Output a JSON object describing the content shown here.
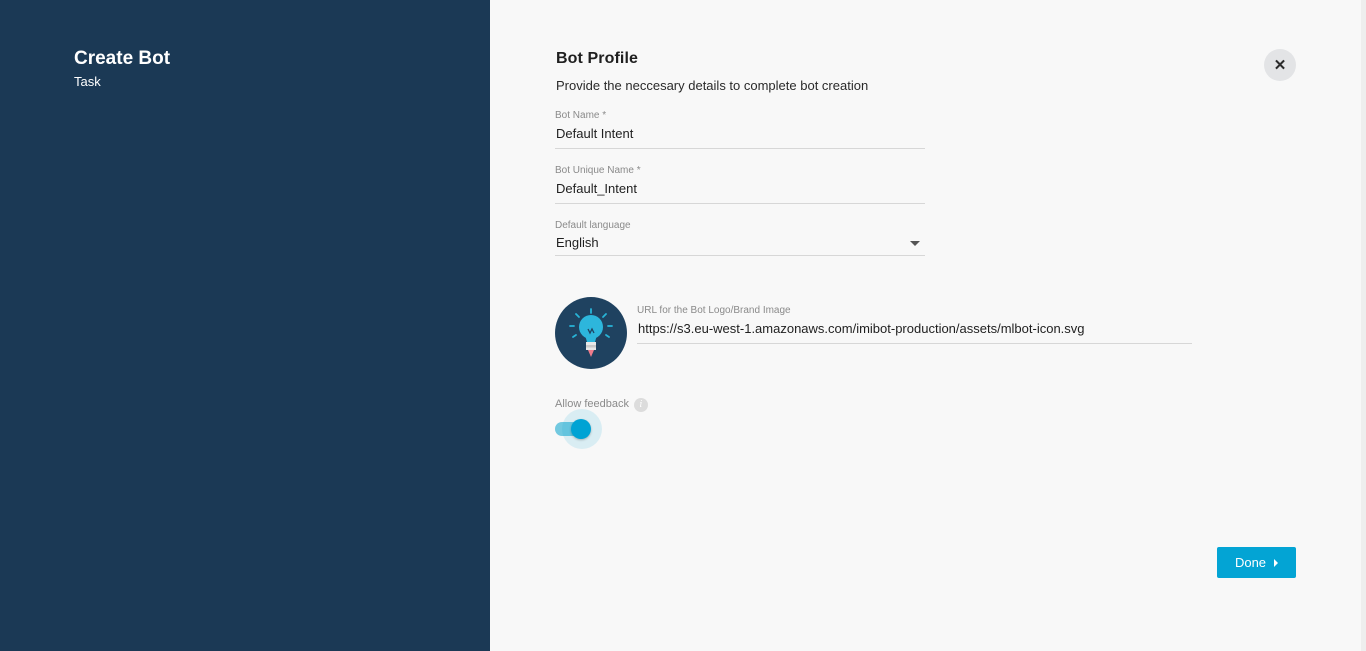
{
  "left_panel": {
    "title": "Create Bot",
    "subtitle": "Task"
  },
  "close_button": {
    "icon": "close-icon",
    "glyph": "✕"
  },
  "profile": {
    "title": "Bot Profile",
    "description": "Provide the neccesary details to complete bot creation"
  },
  "fields": {
    "bot_name": {
      "label": "Bot Name *",
      "value": "Default Intent"
    },
    "bot_unique_name": {
      "label": "Bot Unique Name *",
      "value": "Default_Intent"
    },
    "default_language": {
      "label": "Default language",
      "value": "English"
    },
    "logo_url": {
      "label": "URL for the Bot Logo/Brand Image",
      "value": "https://s3.eu-west-1.amazonaws.com/imibot-production/assets/mlbot-icon.svg"
    }
  },
  "feedback": {
    "label": "Allow feedback",
    "info_glyph": "i",
    "enabled": true
  },
  "done_button": {
    "label": "Done"
  },
  "colors": {
    "sidebar": "#1b3955",
    "accent": "#03a4d4",
    "logo_bg": "#1f4260"
  }
}
